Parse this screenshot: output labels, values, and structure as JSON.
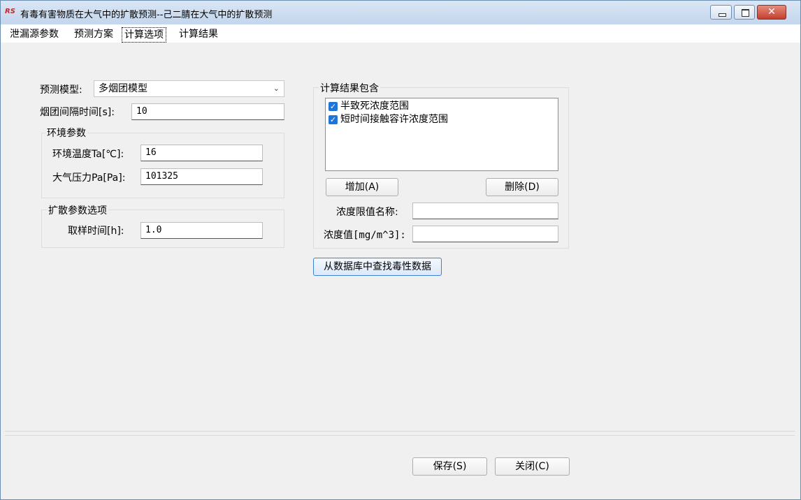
{
  "window": {
    "title": "有毒有害物质在大气中的扩散预测--己二腈在大气中的扩散预测",
    "app_icon_text": "RS",
    "controls": {
      "minimize": "",
      "maximize": "",
      "close": "✕"
    }
  },
  "tabs": [
    {
      "label": "泄漏源参数"
    },
    {
      "label": "预测方案"
    },
    {
      "label": "计算选项",
      "active": true
    },
    {
      "label": "计算结果"
    }
  ],
  "calc": {
    "model_label": "预测模型:",
    "model_value": "多烟团模型",
    "interval_label": "烟团间隔时间[s]:",
    "interval_value": "10",
    "env_group_title": "环境参数",
    "temp_label": "环境温度Ta[℃]:",
    "temp_value": "16",
    "pressure_label": "大气压力Pa[Pa]:",
    "pressure_value": "101325",
    "diffusion_group_title": "扩散参数选项",
    "sampling_label": "取样时间[h]:",
    "sampling_value": "1.0"
  },
  "results": {
    "group_title": "计算结果包含",
    "items": [
      {
        "label": "半致死浓度范围",
        "checked": true
      },
      {
        "label": "短时间接触容许浓度范围",
        "checked": true
      }
    ],
    "add_button": "增加(A)",
    "delete_button": "删除(D)",
    "limit_name_label": "浓度限值名称:",
    "limit_name_value": "",
    "conc_label": "浓度值[mg/m^3]:",
    "conc_value": "",
    "lookup_button": "从数据库中查找毒性数据"
  },
  "footer": {
    "save_button": "保存(S)",
    "close_button": "关闭(C)"
  },
  "colors": {
    "accent": "#1e74d8",
    "title_bar": "#c4d6ec",
    "close_button": "#c44030"
  }
}
